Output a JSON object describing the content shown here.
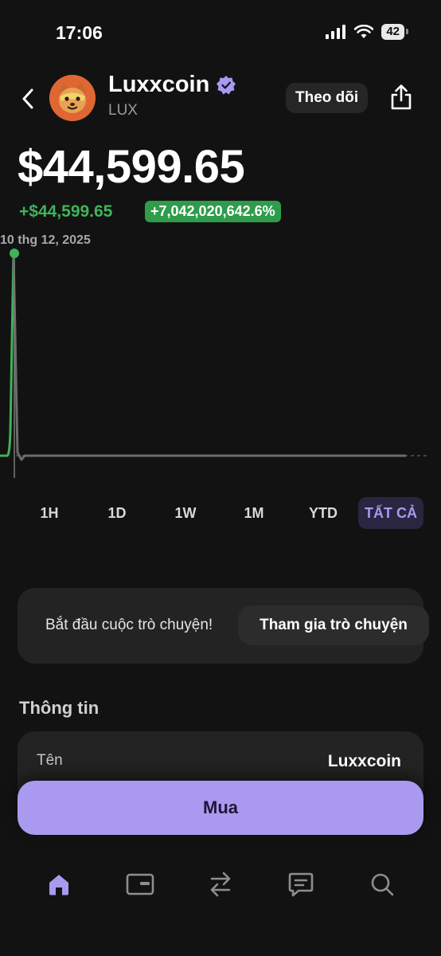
{
  "status_bar": {
    "time": "17:06",
    "battery": "42"
  },
  "header": {
    "name": "Luxxcoin",
    "symbol": "LUX",
    "follow_label": "Theo dõi",
    "icons": [
      "back-chevron-icon",
      "verified-badge-icon",
      "share-icon"
    ]
  },
  "price": {
    "value": "$44,599.65",
    "change_abs": "+$44,599.65",
    "change_pct": "+7,042,020,642.6%"
  },
  "chart_data": {
    "type": "line",
    "selected_point_label": "10 thg 12, 2025",
    "x": [
      "10 thg 12, 2025",
      "",
      "",
      "",
      "",
      "",
      "",
      "",
      "",
      ""
    ],
    "values": [
      44599.65,
      0,
      0,
      0,
      0,
      0,
      0,
      0,
      0,
      0
    ],
    "colors": {
      "up": "#3fb35a",
      "flat": "#6b6b6b"
    }
  },
  "time_ranges": {
    "items": [
      "1H",
      "1D",
      "1W",
      "1M",
      "YTD",
      "TẤT CẢ"
    ],
    "selected": "TẤT CẢ"
  },
  "chat": {
    "prompt": "Bắt đầu cuộc trò chuyện!",
    "join_label": "Tham gia trò chuyện"
  },
  "info": {
    "title": "Thông tin",
    "rows": [
      {
        "label": "Tên",
        "value": "Luxxcoin"
      }
    ]
  },
  "buy_label": "Mua",
  "bottom_nav": {
    "items": [
      "home-icon",
      "wallet-icon",
      "swap-icon",
      "chat-icon",
      "search-icon"
    ],
    "active": "home-icon"
  },
  "colors": {
    "accent": "#a99af0",
    "positive": "#3fb35a",
    "background": "#121212"
  }
}
